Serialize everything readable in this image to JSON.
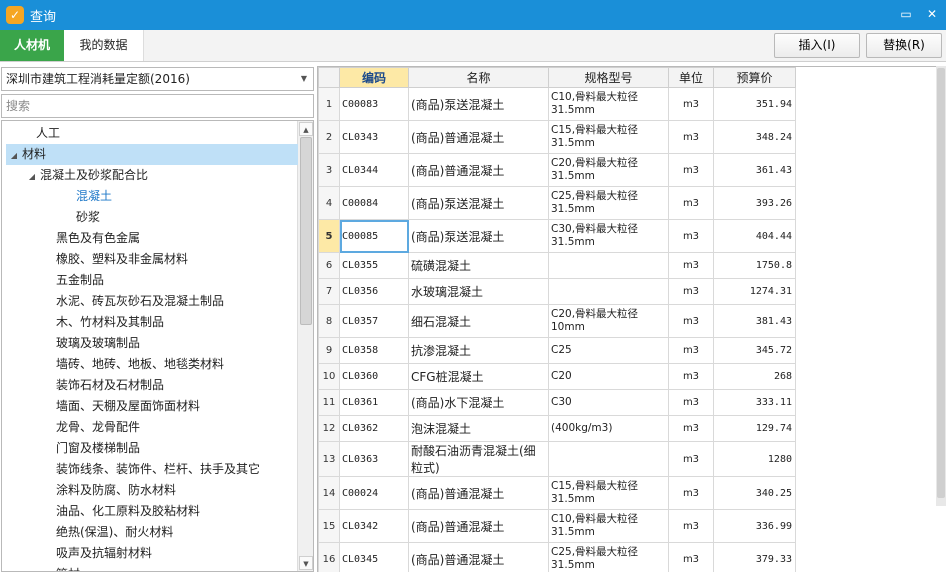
{
  "window": {
    "title": "查询",
    "app_icon_glyph": "✓",
    "maximize_glyph": "▭",
    "close_glyph": "✕"
  },
  "tabs": [
    {
      "label": "人材机"
    },
    {
      "label": "我的数据"
    }
  ],
  "toolbar": {
    "insert_label": "插入(I)",
    "replace_label": "替换(R)"
  },
  "sidebar": {
    "quota_selected": "深圳市建筑工程消耗量定额(2016)",
    "search_placeholder": "搜索",
    "tree": [
      {
        "label": "人工",
        "level": 0,
        "arrow": ""
      },
      {
        "label": "材料",
        "level": 0,
        "arrow": "◢"
      },
      {
        "label": "混凝土及砂浆配合比",
        "level": 1,
        "arrow": "◢"
      },
      {
        "label": "混凝土",
        "level": 2,
        "arrow": ""
      },
      {
        "label": "砂浆",
        "level": 2,
        "arrow": ""
      },
      {
        "label": "黑色及有色金属",
        "level": 1,
        "arrow": ""
      },
      {
        "label": "橡胶、塑料及非金属材料",
        "level": 1,
        "arrow": ""
      },
      {
        "label": "五金制品",
        "level": 1,
        "arrow": ""
      },
      {
        "label": "水泥、砖瓦灰砂石及混凝土制品",
        "level": 1,
        "arrow": ""
      },
      {
        "label": "木、竹材料及其制品",
        "level": 1,
        "arrow": ""
      },
      {
        "label": "玻璃及玻璃制品",
        "level": 1,
        "arrow": ""
      },
      {
        "label": "墙砖、地砖、地板、地毯类材料",
        "level": 1,
        "arrow": ""
      },
      {
        "label": "装饰石材及石材制品",
        "level": 1,
        "arrow": ""
      },
      {
        "label": "墙面、天棚及屋面饰面材料",
        "level": 1,
        "arrow": ""
      },
      {
        "label": "龙骨、龙骨配件",
        "level": 1,
        "arrow": ""
      },
      {
        "label": "门窗及楼梯制品",
        "level": 1,
        "arrow": ""
      },
      {
        "label": "装饰线条、装饰件、栏杆、扶手及其它",
        "level": 1,
        "arrow": ""
      },
      {
        "label": "涂料及防腐、防水材料",
        "level": 1,
        "arrow": ""
      },
      {
        "label": "油品、化工原料及胶粘材料",
        "level": 1,
        "arrow": ""
      },
      {
        "label": "绝热(保温)、耐火材料",
        "level": 1,
        "arrow": ""
      },
      {
        "label": "吸声及抗辐射材料",
        "level": 1,
        "arrow": ""
      },
      {
        "label": "管材",
        "level": 1,
        "arrow": ""
      }
    ]
  },
  "grid": {
    "columns": [
      "编码",
      "名称",
      "规格型号",
      "单位",
      "预算价"
    ],
    "rows": [
      {
        "no": "1",
        "code": "C00083",
        "name": "(商品)泵送混凝土",
        "spec": "C10,骨料最大粒径31.5mm",
        "unit": "m3",
        "price": "351.94"
      },
      {
        "no": "2",
        "code": "CL0343",
        "name": "(商品)普通混凝土",
        "spec": "C15,骨料最大粒径31.5mm",
        "unit": "m3",
        "price": "348.24"
      },
      {
        "no": "3",
        "code": "CL0344",
        "name": "(商品)普通混凝土",
        "spec": "C20,骨料最大粒径31.5mm",
        "unit": "m3",
        "price": "361.43"
      },
      {
        "no": "4",
        "code": "C00084",
        "name": "(商品)泵送混凝土",
        "spec": "C25,骨料最大粒径31.5mm",
        "unit": "m3",
        "price": "393.26"
      },
      {
        "no": "5",
        "code": "C00085",
        "name": "(商品)泵送混凝土",
        "spec": "C30,骨料最大粒径31.5mm",
        "unit": "m3",
        "price": "404.44"
      },
      {
        "no": "6",
        "code": "CL0355",
        "name": "硫磺混凝土",
        "spec": "",
        "unit": "m3",
        "price": "1750.8"
      },
      {
        "no": "7",
        "code": "CL0356",
        "name": "水玻璃混凝土",
        "spec": "",
        "unit": "m3",
        "price": "1274.31"
      },
      {
        "no": "8",
        "code": "CL0357",
        "name": "细石混凝土",
        "spec": "C20,骨料最大粒径10mm",
        "unit": "m3",
        "price": "381.43"
      },
      {
        "no": "9",
        "code": "CL0358",
        "name": "抗渗混凝土",
        "spec": "C25",
        "unit": "m3",
        "price": "345.72"
      },
      {
        "no": "10",
        "code": "CL0360",
        "name": "CFG桩混凝土",
        "spec": "C20",
        "unit": "m3",
        "price": "268"
      },
      {
        "no": "11",
        "code": "CL0361",
        "name": "(商品)水下混凝土",
        "spec": "C30",
        "unit": "m3",
        "price": "333.11"
      },
      {
        "no": "12",
        "code": "CL0362",
        "name": "泡沫混凝土",
        "spec": "(400kg/m3)",
        "unit": "m3",
        "price": "129.74"
      },
      {
        "no": "13",
        "code": "CL0363",
        "name": "耐酸石油沥青混凝土(细粒式)",
        "spec": "",
        "unit": "m3",
        "price": "1280"
      },
      {
        "no": "14",
        "code": "C00024",
        "name": "(商品)普通混凝土",
        "spec": "C15,骨料最大粒径31.5mm",
        "unit": "m3",
        "price": "340.25"
      },
      {
        "no": "15",
        "code": "CL0342",
        "name": "(商品)普通混凝土",
        "spec": "C10,骨料最大粒径31.5mm",
        "unit": "m3",
        "price": "336.99"
      },
      {
        "no": "16",
        "code": "CL0345",
        "name": "(商品)普通混凝土",
        "spec": "C25,骨料最大粒径31.5mm",
        "unit": "m3",
        "price": "379.33"
      }
    ]
  },
  "colors": {
    "titlebar": "#1a8fd8",
    "active_tab": "#3aa54a",
    "selected_row_header": "#fde9a6",
    "tree_highlight": "#bfe0f7",
    "tree_selected_text": "#1e78c8"
  }
}
